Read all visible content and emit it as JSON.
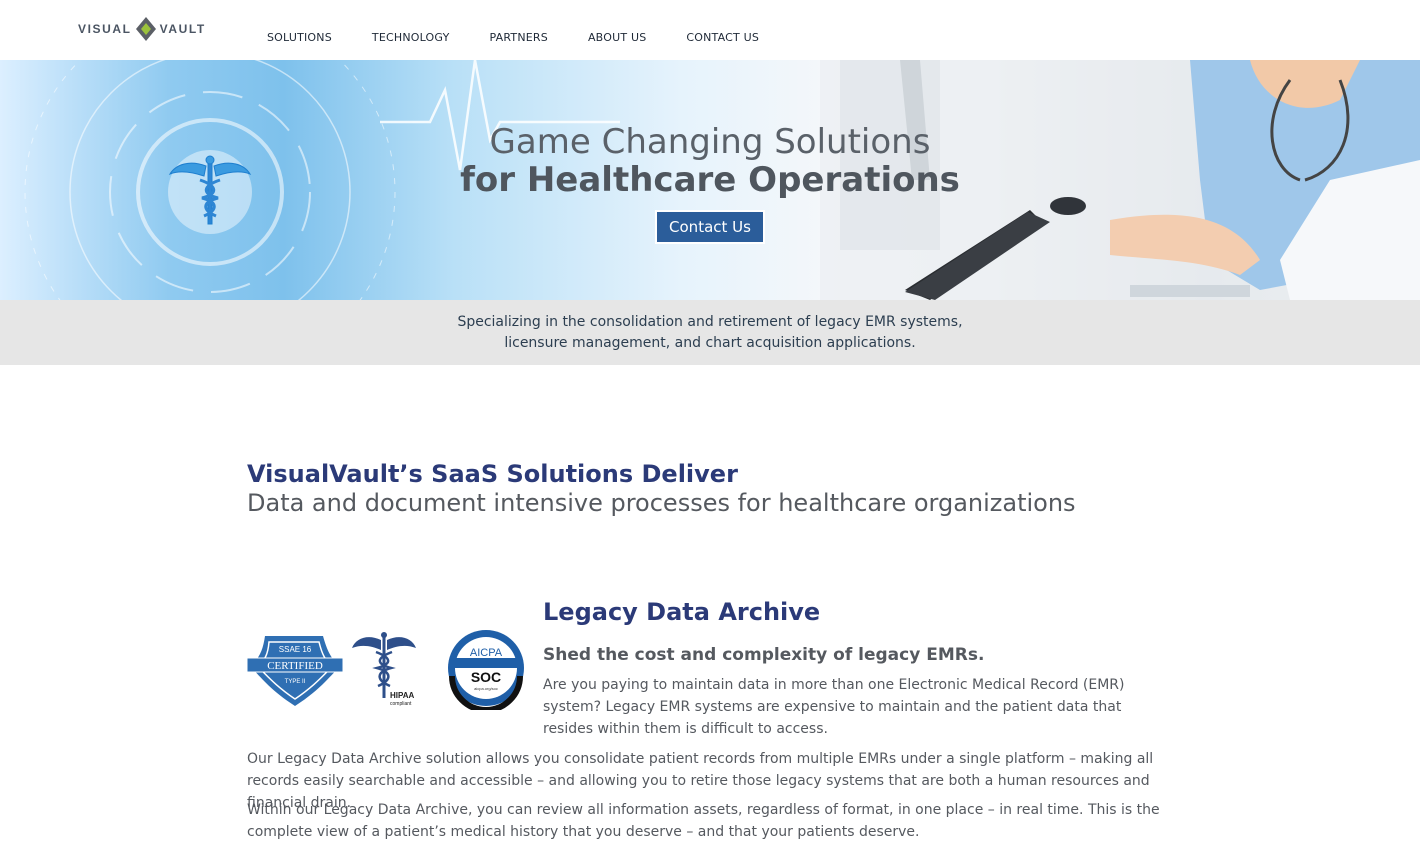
{
  "brand": {
    "logo_left": "VISUAL",
    "logo_right": "VAULT",
    "accent": "#2b5d9a",
    "heading_color": "#2b3a78"
  },
  "nav": {
    "items": [
      {
        "label": "SOLUTIONS"
      },
      {
        "label": "TECHNOLOGY"
      },
      {
        "label": "PARTNERS"
      },
      {
        "label": "ABOUT US"
      },
      {
        "label": "CONTACT US"
      }
    ]
  },
  "hero": {
    "title_line1": "Game Changing Solutions",
    "title_line2": "for Healthcare Operations",
    "cta_label": "Contact Us"
  },
  "tagline": {
    "line1": "Specializing in the consolidation and retirement of legacy EMR systems,",
    "line2": "licensure management, and chart acquisition applications."
  },
  "solutions": {
    "heading": "VisualVault’s SaaS Solutions Deliver",
    "subheading": "Data and document intensive processes for healthcare organizations"
  },
  "badges": {
    "ssae_top": "SSAE 16",
    "ssae_main": "CERTIFIED",
    "ssae_bottom": "TYPE II",
    "hipaa_label": "HIPAA",
    "hipaa_sub": "compliant",
    "aicpa_top": "AICPA",
    "aicpa_main": "SOC",
    "aicpa_url": "aicpa.org/soc"
  },
  "legacy": {
    "title": "Legacy Data Archive",
    "subtitle": "Shed the cost and complexity of legacy EMRs.",
    "para1": "Are you paying to maintain data in more than one Electronic Medical Record (EMR) system? Legacy EMR systems are expensive to maintain and the patient data that resides within them is difficult to access.",
    "para2": "Our Legacy Data Archive solution allows you consolidate patient records from multiple EMRs under a single platform – making all records easily searchable and accessible – and allowing you to retire those legacy systems that are both a human resources and financial drain.",
    "para3": "Within our Legacy Data Archive, you can review all information assets, regardless of format, in one place – in real time. This is the complete view of a patient’s medical history that you deserve – and that your patients deserve."
  }
}
